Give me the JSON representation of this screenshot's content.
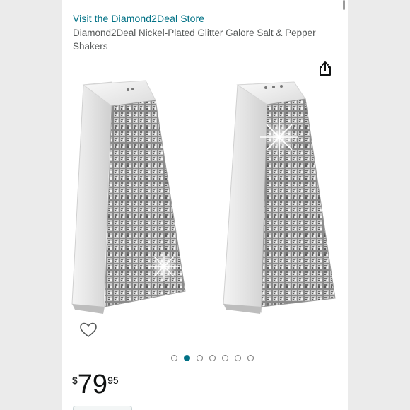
{
  "store": {
    "link_label": "Visit the Diamond2Deal Store"
  },
  "product": {
    "title": "Diamond2Deal Nickel-Plated Glitter Galore Salt & Pepper Shakers"
  },
  "icons": {
    "share": "share-icon",
    "wishlist": "heart-icon"
  },
  "gallery": {
    "image_count": 7,
    "active_index": 1,
    "dots": [
      "",
      "",
      "",
      "",
      "",
      "",
      ""
    ]
  },
  "price": {
    "symbol": "$",
    "whole": "79",
    "fraction": "95"
  },
  "colors": {
    "link": "#007185",
    "title_text": "#565959",
    "price_text": "#0f1111",
    "active_dot": "#007185",
    "background": "#ebebeb"
  }
}
